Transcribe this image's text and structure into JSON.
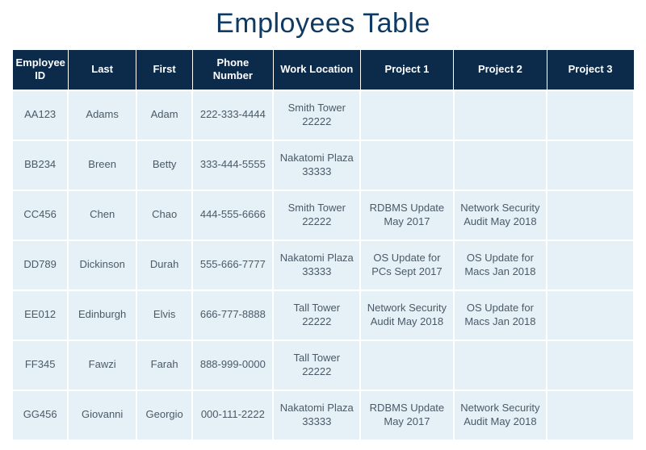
{
  "title": "Employees Table",
  "columns": [
    "Employee ID",
    "Last",
    "First",
    "Phone Number",
    "Work Location",
    "Project 1",
    "Project 2",
    "Project 3"
  ],
  "rows": [
    {
      "emp_id": "AA123",
      "last": "Adams",
      "first": "Adam",
      "phone": "222-333-4444",
      "location": "Smith Tower 22222",
      "p1": "",
      "p2": "",
      "p3": ""
    },
    {
      "emp_id": "BB234",
      "last": "Breen",
      "first": "Betty",
      "phone": "333-444-5555",
      "location": "Nakatomi Plaza 33333",
      "p1": "",
      "p2": "",
      "p3": ""
    },
    {
      "emp_id": "CC456",
      "last": "Chen",
      "first": "Chao",
      "phone": "444-555-6666",
      "location": "Smith Tower 22222",
      "p1": "RDBMS Update May 2017",
      "p2": "Network Security Audit May 2018",
      "p3": ""
    },
    {
      "emp_id": "DD789",
      "last": "Dickinson",
      "first": "Durah",
      "phone": "555-666-7777",
      "location": "Nakatomi Plaza 33333",
      "p1": "OS Update for PCs Sept 2017",
      "p2": "OS Update for Macs Jan 2018",
      "p3": ""
    },
    {
      "emp_id": "EE012",
      "last": "Edinburgh",
      "first": "Elvis",
      "phone": "666-777-8888",
      "location": "Tall Tower 22222",
      "p1": "Network Security Audit May 2018",
      "p2": "OS Update for Macs Jan 2018",
      "p3": ""
    },
    {
      "emp_id": "FF345",
      "last": "Fawzi",
      "first": "Farah",
      "phone": "888-999-0000",
      "location": "Tall Tower 22222",
      "p1": "",
      "p2": "",
      "p3": ""
    },
    {
      "emp_id": "GG456",
      "last": "Giovanni",
      "first": "Georgio",
      "phone": "000-111-2222",
      "location": "Nakatomi Plaza 33333",
      "p1": "RDBMS Update May 2017",
      "p2": "Network Security Audit May 2018",
      "p3": ""
    }
  ]
}
